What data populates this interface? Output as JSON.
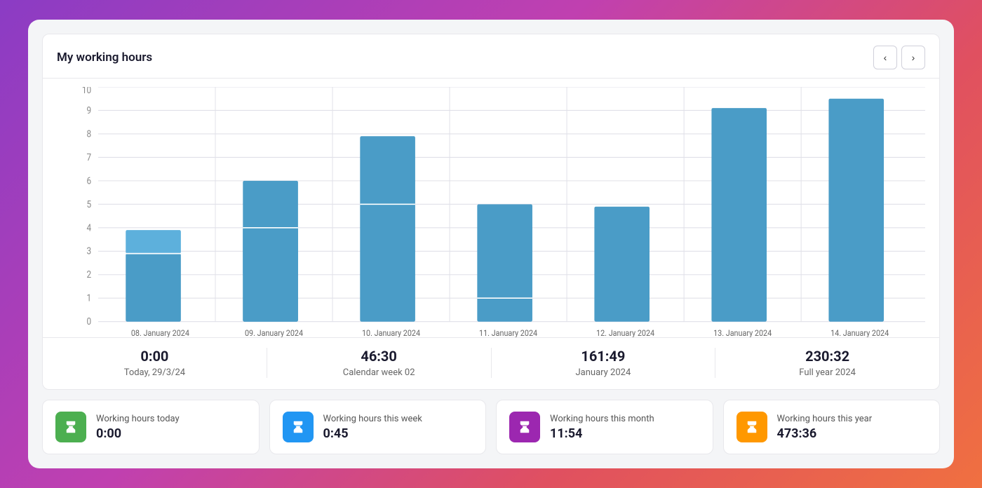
{
  "header": {
    "title": "My working hours",
    "nav_prev": "‹",
    "nav_next": "›"
  },
  "chart": {
    "y_labels": [
      "0",
      "1",
      "2",
      "3",
      "4",
      "5",
      "6",
      "7",
      "8",
      "9",
      "10"
    ],
    "bars": [
      {
        "date": "08. January 2024",
        "total": 3.9,
        "lower": 2.9,
        "upper": 1.0,
        "color": "#4A9CC7"
      },
      {
        "date": "09. January 2024",
        "total": 6.0,
        "lower": 4.0,
        "upper": 2.0,
        "color": "#4A9CC7"
      },
      {
        "date": "10. January 2024",
        "total": 7.9,
        "lower": 5.0,
        "upper": 2.9,
        "color": "#4A9CC7"
      },
      {
        "date": "11. January 2024",
        "total": 5.0,
        "lower": 1.0,
        "upper": 4.0,
        "color": "#4A9CC7"
      },
      {
        "date": "12. January 2024",
        "total": 4.9,
        "lower": 4.9,
        "upper": 0.0,
        "color": "#4A9CC7"
      },
      {
        "date": "13. January 2024",
        "total": 9.1,
        "lower": 9.1,
        "upper": 0.0,
        "color": "#4A9CC7"
      },
      {
        "date": "14. January 2024",
        "total": 9.5,
        "lower": 9.5,
        "upper": 0.0,
        "color": "#4A9CC7"
      }
    ],
    "y_max": 10
  },
  "summary": [
    {
      "time": "0:00",
      "label": "Today, 29/3/24"
    },
    {
      "time": "46:30",
      "label": "Calendar week 02"
    },
    {
      "time": "161:49",
      "label": "January 2024"
    },
    {
      "time": "230:32",
      "label": "Full year 2024"
    }
  ],
  "stats": [
    {
      "name": "Working hours today",
      "value": "0:00",
      "icon_color": "green",
      "icon": "⧗"
    },
    {
      "name": "Working hours this week",
      "value": "0:45",
      "icon_color": "blue",
      "icon": "⧗"
    },
    {
      "name": "Working hours this month",
      "value": "11:54",
      "icon_color": "purple",
      "icon": "⧗"
    },
    {
      "name": "Working hours this year",
      "value": "473:36",
      "icon_color": "orange",
      "icon": "⧗"
    }
  ]
}
